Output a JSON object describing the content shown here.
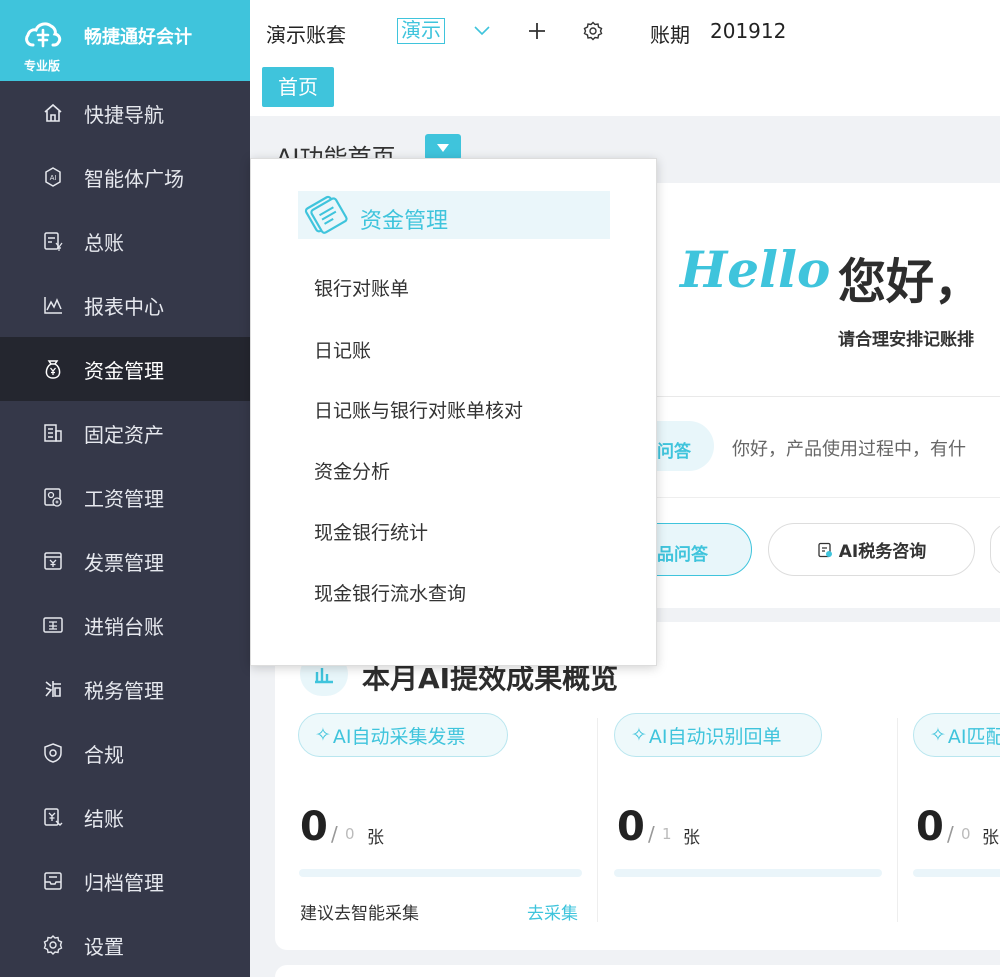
{
  "brand": {
    "name": "畅捷通好会计",
    "edition": "专业版"
  },
  "sidebar": {
    "items": [
      {
        "label": "快捷导航",
        "icon": "home-icon"
      },
      {
        "label": "智能体广场",
        "icon": "ai-icon"
      },
      {
        "label": "总账",
        "icon": "ledger-icon"
      },
      {
        "label": "报表中心",
        "icon": "chart-icon"
      },
      {
        "label": "资金管理",
        "icon": "money-bag-icon",
        "active": true
      },
      {
        "label": "固定资产",
        "icon": "building-icon"
      },
      {
        "label": "工资管理",
        "icon": "salary-icon"
      },
      {
        "label": "发票管理",
        "icon": "invoice-icon"
      },
      {
        "label": "进销台账",
        "icon": "inventory-icon"
      },
      {
        "label": "税务管理",
        "icon": "tax-icon"
      },
      {
        "label": "合规",
        "icon": "shield-icon"
      },
      {
        "label": "结账",
        "icon": "closing-icon"
      },
      {
        "label": "归档管理",
        "icon": "archive-icon"
      },
      {
        "label": "设置",
        "icon": "gear-icon"
      }
    ]
  },
  "topbar": {
    "account_name": "演示账套",
    "account_tag": "演示",
    "period_label": "账期",
    "period_value": "201912"
  },
  "tabs": {
    "home": "首页"
  },
  "page": {
    "section_title": "AI功能首页"
  },
  "hero": {
    "hello": "Hello",
    "greeting": "您好，",
    "subtitle": "请合理安排记账排"
  },
  "ai_qa": {
    "pill_label": "问答",
    "hint": "你好，产品使用过程中，有什",
    "btn_qa": "品问答",
    "btn_tax": "AI税务咨询"
  },
  "results": {
    "title": "本月AI提效成果概览",
    "cards": [
      {
        "tag": "AI自动采集发票",
        "value": "0",
        "slash": "/",
        "total": "0",
        "unit": "张",
        "suggest": "建议去智能采集",
        "action": "去采集"
      },
      {
        "tag": "AI自动识别回单",
        "value": "0",
        "slash": "/",
        "total": "1",
        "unit": "张"
      },
      {
        "tag": "AI匹配",
        "value": "0",
        "slash": "/",
        "total": "0",
        "unit": "张"
      }
    ]
  },
  "dropdown": {
    "header": "资金管理",
    "items": [
      "银行对账单",
      "日记账",
      "日记账与银行对账单核对",
      "资金分析",
      "现金银行统计",
      "现金银行流水查询"
    ]
  },
  "colors": {
    "accent": "#3fc4dc",
    "sidebar_bg": "#353849",
    "sidebar_active": "#24262f"
  }
}
